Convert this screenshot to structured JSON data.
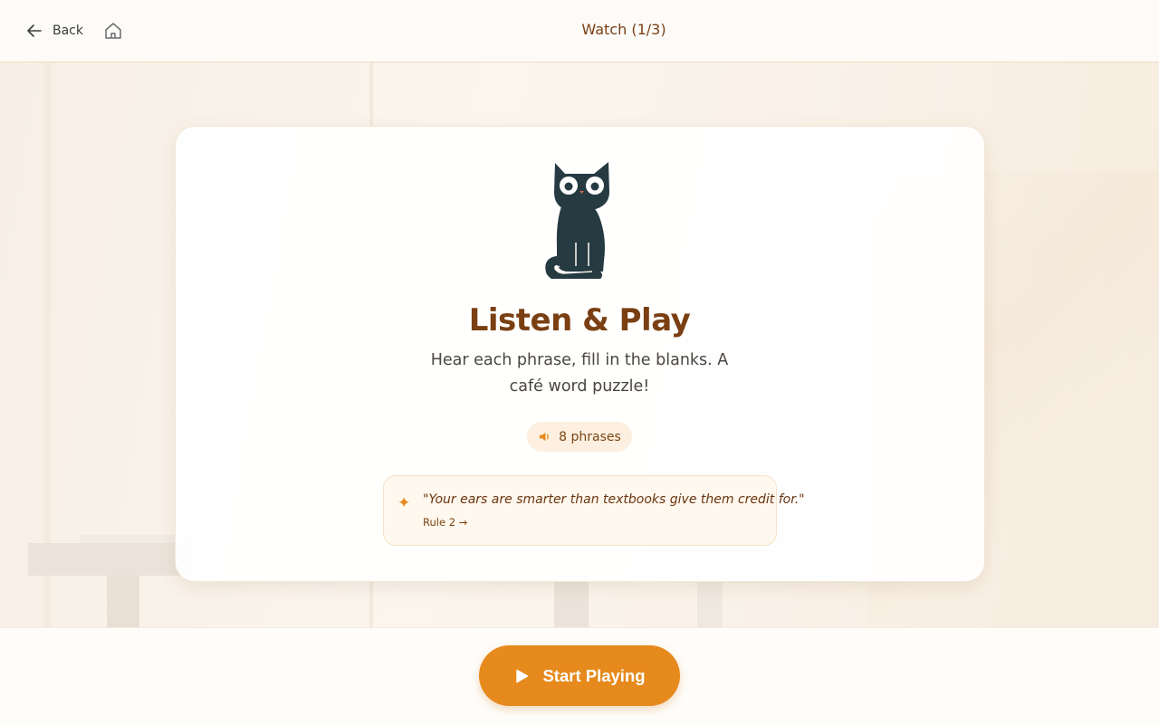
{
  "header": {
    "back_label": "Back",
    "title": "Watch (1/3)"
  },
  "card": {
    "title": "Listen & Play",
    "description": "Hear each phrase, fill in the blanks. A café word puzzle!",
    "badge": "8 phrases",
    "quote": "\"Your ears are smarter than textbooks give them credit for.\"",
    "rule_link": "Rule 2 →"
  },
  "footer": {
    "start_label": "Start Playing"
  },
  "icons": {
    "back": "arrow-left-icon",
    "home": "home-icon",
    "mascot": "cat-mascot-icon",
    "speaker": "speaker-icon",
    "sparkle": "sparkle-icon",
    "play": "play-icon"
  },
  "colors": {
    "accent": "#e68a1d",
    "title_brown": "#7a3f12",
    "cat": "#263a42"
  }
}
